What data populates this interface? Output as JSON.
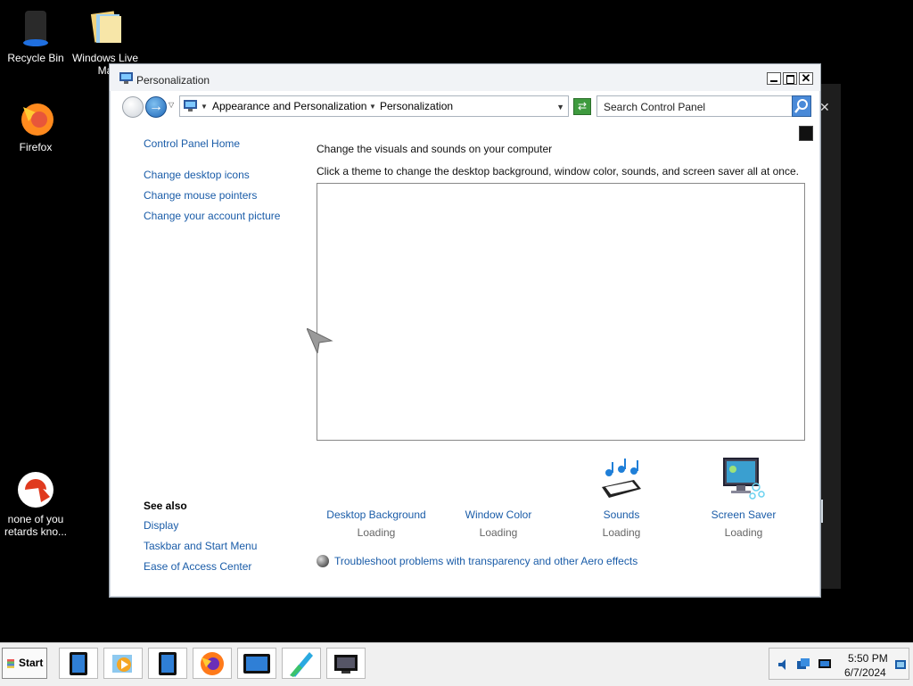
{
  "desktop": {
    "icons": [
      {
        "label": "Recycle Bin"
      },
      {
        "label": "Windows Live Ma"
      },
      {
        "label": "Firefox"
      },
      {
        "label": "none of you retards kno..."
      }
    ]
  },
  "window": {
    "title": "Personalization",
    "breadcrumb": [
      "Appearance and Personalization",
      "Personalization"
    ],
    "search_placeholder": "Search Control Panel"
  },
  "left_panel": {
    "home": "Control Panel Home",
    "links": [
      "Change desktop icons",
      "Change mouse pointers",
      "Change your account picture"
    ],
    "see_also_title": "See also",
    "see_also": [
      "Display",
      "Taskbar and Start Menu",
      "Ease of Access Center"
    ]
  },
  "main": {
    "heading": "Change the visuals and sounds on your computer",
    "subheading": "Click a theme to change the desktop background, window color, sounds, and screen saver all at once.",
    "items": [
      {
        "label": "Desktop Background",
        "status": "Loading"
      },
      {
        "label": "Window Color",
        "status": "Loading"
      },
      {
        "label": "Sounds",
        "status": "Loading"
      },
      {
        "label": "Screen Saver",
        "status": "Loading"
      }
    ],
    "troubleshoot": "Troubleshoot problems with transparency and other Aero effects"
  },
  "taskbar": {
    "start_label": "Start",
    "time": "5:50 PM",
    "date": "6/7/2024"
  }
}
